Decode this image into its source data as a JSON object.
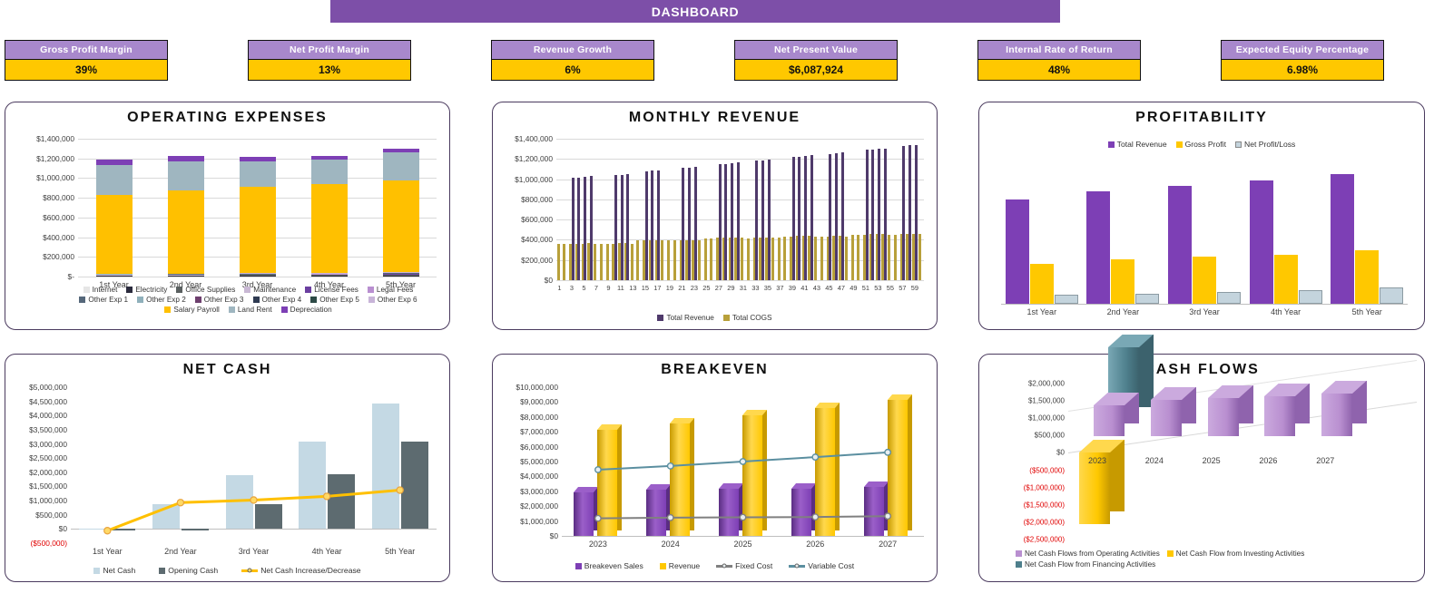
{
  "header": {
    "title": "DASHBOARD",
    "bar_color": "#7d4fa8"
  },
  "kpis": [
    {
      "label": "Gross Profit Margin",
      "value": "39%"
    },
    {
      "label": "Net Profit Margin",
      "value": "13%"
    },
    {
      "label": "Revenue Growth",
      "value": "6%"
    },
    {
      "label": "Net Present Value",
      "value": "$6,087,924"
    },
    {
      "label": "Internal Rate of Return",
      "value": "48%"
    },
    {
      "label": "Expected Equity Percentage",
      "value": "6.98%"
    }
  ],
  "colors": {
    "purple_dark": "#7d4fa8",
    "purple_light": "#a888cc",
    "yellow": "#ffc800",
    "gold": "#e8c020",
    "blue_gray": "#9fb6c0",
    "slate": "#5d6b70",
    "pale_blue": "#c4d4dd",
    "teal": "#4e7f8c",
    "negative_red": "#e00000"
  },
  "chart_data": [
    {
      "id": "operating-expenses",
      "type": "bar",
      "title": "OPERATING EXPENSES",
      "stacked": true,
      "categories": [
        "1st Year",
        "2nd Year",
        "3rd Year",
        "4th Year",
        "5th Year"
      ],
      "ylim": [
        0,
        1400000
      ],
      "yticks": [
        0,
        200000,
        400000,
        600000,
        800000,
        1000000,
        1200000,
        1400000
      ],
      "ytick_labels": [
        "$-",
        "$200,000",
        "$400,000",
        "$600,000",
        "$800,000",
        "$1,000,000",
        "$1,200,000",
        "$1,400,000"
      ],
      "grid": true,
      "legend_position": "bottom",
      "series": [
        {
          "name": "Internet",
          "color": "#e6e6e6",
          "values": [
            2000,
            2100,
            2200,
            2300,
            2400
          ]
        },
        {
          "name": "Electricity",
          "color": "#2b2b3d",
          "values": [
            9000,
            9500,
            10000,
            10500,
            11000
          ]
        },
        {
          "name": "Office Supplies",
          "color": "#5a6060",
          "values": [
            4000,
            4200,
            4400,
            4600,
            4800
          ]
        },
        {
          "name": "Maintenance",
          "color": "#c9b8d4",
          "values": [
            3000,
            3200,
            3400,
            3600,
            3800
          ]
        },
        {
          "name": "License Fees",
          "color": "#6b3fa0",
          "values": [
            2500,
            2600,
            2700,
            2800,
            2900
          ]
        },
        {
          "name": "Legal Fees",
          "color": "#b98fd0",
          "values": [
            2000,
            2100,
            2200,
            2300,
            9000
          ]
        },
        {
          "name": "Other Exp 1",
          "color": "#55677a",
          "values": [
            1500,
            1600,
            1700,
            1800,
            1900
          ]
        },
        {
          "name": "Other Exp 2",
          "color": "#8fb0bb",
          "values": [
            1500,
            1600,
            1700,
            1800,
            1900
          ]
        },
        {
          "name": "Other Exp 3",
          "color": "#6e3f6e",
          "values": [
            1200,
            1300,
            1400,
            1500,
            1600
          ]
        },
        {
          "name": "Other Exp 4",
          "color": "#2f3b52",
          "values": [
            1200,
            1300,
            1400,
            1500,
            1600
          ]
        },
        {
          "name": "Other Exp 5",
          "color": "#2d4a46",
          "values": [
            1000,
            1100,
            1200,
            1300,
            1400
          ]
        },
        {
          "name": "Other Exp 6",
          "color": "#c8b4d8",
          "values": [
            1000,
            1100,
            1200,
            1300,
            1400
          ]
        },
        {
          "name": "Salary Payroll",
          "color": "#ffc000",
          "values": [
            800000,
            845000,
            880000,
            900000,
            930000
          ]
        },
        {
          "name": "Land Rent",
          "color": "#9fb6c0",
          "values": [
            300000,
            290000,
            255000,
            250000,
            290000
          ]
        },
        {
          "name": "Depreciation",
          "color": "#7d3fb5",
          "values": [
            60000,
            55000,
            50000,
            40000,
            35000
          ]
        }
      ]
    },
    {
      "id": "monthly-revenue",
      "type": "bar",
      "title": "MONTHLY REVENUE",
      "xlabel": "",
      "ylim": [
        0,
        1400000
      ],
      "yticks": [
        0,
        200000,
        400000,
        600000,
        800000,
        1000000,
        1200000,
        1400000
      ],
      "ytick_labels": [
        "$0",
        "$200,000",
        "$400,000",
        "$600,000",
        "$800,000",
        "$1,000,000",
        "$1,200,000",
        "$1,400,000"
      ],
      "xticks": [
        1,
        3,
        5,
        7,
        9,
        11,
        13,
        15,
        17,
        19,
        21,
        23,
        25,
        27,
        29,
        31,
        33,
        35,
        37,
        39,
        41,
        43,
        45,
        47,
        49,
        51,
        53,
        55,
        57,
        59
      ],
      "months": 60,
      "grid": true,
      "legend_position": "bottom",
      "series": [
        {
          "name": "Total Revenue",
          "color": "#4f3a6b",
          "values": [
            0,
            0,
            1010000,
            1012000,
            1022000,
            1030000,
            0,
            0,
            0,
            1040000,
            1045000,
            1048000,
            0,
            0,
            1075000,
            1082000,
            1088000,
            0,
            0,
            0,
            1110000,
            1115000,
            1120000,
            0,
            0,
            0,
            1148000,
            1152000,
            1160000,
            1168000,
            0,
            0,
            1185000,
            1188000,
            1195000,
            0,
            0,
            0,
            1218000,
            1222000,
            1228000,
            1236000,
            0,
            0,
            1252000,
            1258000,
            1262000,
            0,
            0,
            0,
            1288000,
            1292000,
            1298000,
            1302000,
            0,
            0,
            1330000,
            1336000,
            1340000,
            0
          ]
        },
        {
          "name": "Total COGS",
          "color": "#b8a03a",
          "values": [
            358000,
            358000,
            360000,
            362000,
            362000,
            364000,
            358000,
            358000,
            358000,
            362000,
            364000,
            364000,
            358000,
            392000,
            396000,
            398000,
            398000,
            398000,
            394000,
            392000,
            396000,
            398000,
            398000,
            392000,
            414000,
            416000,
            418000,
            418000,
            420000,
            420000,
            418000,
            416000,
            418000,
            420000,
            420000,
            418000,
            424000,
            430000,
            434000,
            436000,
            436000,
            436000,
            430000,
            432000,
            434000,
            436000,
            436000,
            432000,
            446000,
            450000,
            452000,
            454000,
            456000,
            456000,
            452000,
            452000,
            456000,
            458000,
            460000,
            456000
          ]
        }
      ]
    },
    {
      "id": "profitability",
      "type": "bar",
      "title": "PROFITABILITY",
      "categories": [
        "1st Year",
        "2nd Year",
        "3rd Year",
        "4th Year",
        "5th Year"
      ],
      "grid": false,
      "legend_position": "top",
      "ylim": [
        0,
        1400000
      ],
      "series": [
        {
          "name": "Total Revenue",
          "color": "#7d3fb5",
          "values": [
            1060000,
            1135000,
            1190000,
            1245000,
            1310000
          ]
        },
        {
          "name": "Gross Profit",
          "color": "#ffc800",
          "values": [
            405000,
            450000,
            475000,
            495000,
            540000
          ]
        },
        {
          "name": "Net Profit/Loss",
          "color": "#c4d4dd",
          "values": [
            90000,
            100000,
            120000,
            140000,
            165000
          ]
        }
      ]
    },
    {
      "id": "net-cash",
      "type": "combo",
      "title": "NET CASH",
      "categories": [
        "1st Year",
        "2nd Year",
        "3rd Year",
        "4th Year",
        "5th Year"
      ],
      "ylim": [
        -500000,
        5000000
      ],
      "yticks": [
        -500000,
        0,
        500000,
        1000000,
        1500000,
        2000000,
        2500000,
        3000000,
        3500000,
        4000000,
        4500000,
        5000000
      ],
      "ytick_labels": [
        "($500,000)",
        "$0",
        "$500,000",
        "$1,000,000",
        "$1,500,000",
        "$2,000,000",
        "$2,500,000",
        "$3,000,000",
        "$3,500,000",
        "$4,000,000",
        "$4,500,000",
        "$5,000,000"
      ],
      "grid": false,
      "legend_position": "bottom",
      "series": [
        {
          "name": "Net Cash",
          "type": "bar",
          "color": "#c4d9e4",
          "values": [
            20000,
            880000,
            1900000,
            3080000,
            4420000
          ]
        },
        {
          "name": "Opening Cash",
          "type": "bar",
          "color": "#5d6b70",
          "values": [
            0,
            -40000,
            880000,
            1920000,
            3070000
          ]
        },
        {
          "name": "Net Cash Increase/Decrease",
          "type": "line",
          "color": "#ffc000",
          "values": [
            -60000,
            930000,
            1020000,
            1150000,
            1370000
          ]
        }
      ]
    },
    {
      "id": "breakeven",
      "type": "combo",
      "title": "BREAKEVEN",
      "categories": [
        "2023",
        "2024",
        "2025",
        "2026",
        "2027"
      ],
      "ylim": [
        0,
        10000000
      ],
      "yticks": [
        0,
        1000000,
        2000000,
        3000000,
        4000000,
        5000000,
        6000000,
        7000000,
        8000000,
        9000000,
        10000000
      ],
      "ytick_labels": [
        "$0",
        "$1,000,000",
        "$2,000,000",
        "$3,000,000",
        "$4,000,000",
        "$5,000,000",
        "$6,000,000",
        "$7,000,000",
        "$8,000,000",
        "$9,000,000",
        "$10,000,000"
      ],
      "grid": false,
      "legend_position": "bottom",
      "series": [
        {
          "name": "Breakeven Sales",
          "type": "bar",
          "color": "#7d3fb5",
          "values": [
            2950000,
            3080000,
            3150000,
            3200000,
            3270000
          ]
        },
        {
          "name": "Revenue",
          "type": "bar",
          "color": "#ffc800",
          "values": [
            7150000,
            7580000,
            8080000,
            8580000,
            9120000
          ]
        },
        {
          "name": "Fixed Cost",
          "type": "line",
          "color": "#808080",
          "values": [
            1180000,
            1230000,
            1250000,
            1270000,
            1330000
          ]
        },
        {
          "name": "Variable Cost",
          "type": "line",
          "color": "#5b8fa0",
          "values": [
            4450000,
            4700000,
            5000000,
            5300000,
            5620000
          ]
        }
      ]
    },
    {
      "id": "cash-flows",
      "type": "bar",
      "title": "CASH FLOWS",
      "three_d": true,
      "categories": [
        "2023",
        "2024",
        "2025",
        "2026",
        "2027"
      ],
      "ylim": [
        -2500000,
        2000000
      ],
      "yticks": [
        -2500000,
        -2000000,
        -1500000,
        -1000000,
        -500000,
        0,
        500000,
        1000000,
        1500000,
        2000000
      ],
      "ytick_labels": [
        "($2,500,000)",
        "($2,000,000)",
        "($1,500,000)",
        "($1,000,000)",
        "($500,000)",
        "$0",
        "$500,000",
        "$1,000,000",
        "$1,500,000",
        "$2,000,000"
      ],
      "grid": false,
      "legend_position": "bottom",
      "series": [
        {
          "name": "Net Cash Flows from Operating Activities",
          "color": "#b98fd0",
          "values": [
            900000,
            1050000,
            1100000,
            1170000,
            1250000
          ]
        },
        {
          "name": "Net Cash Flow from Investing Activities",
          "color": "#ffc800",
          "values": [
            -2050000,
            0,
            0,
            0,
            0
          ]
        },
        {
          "name": "Net Cash Flow from Financing Activities",
          "color": "#4e7f8c",
          "values": [
            2100000,
            0,
            0,
            0,
            0
          ]
        }
      ]
    }
  ]
}
